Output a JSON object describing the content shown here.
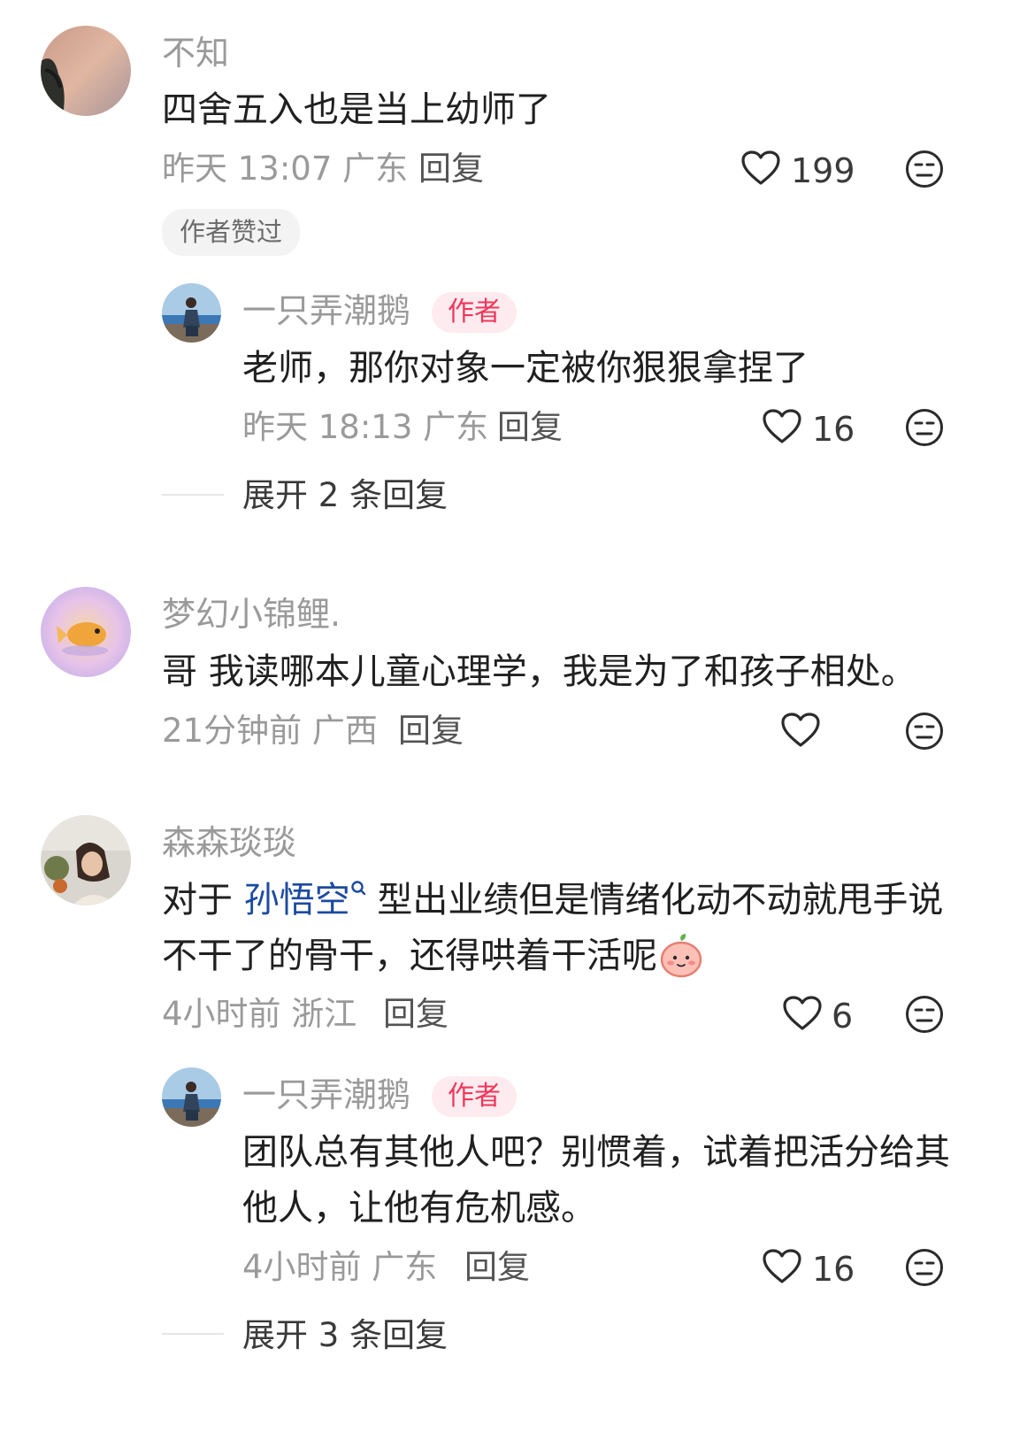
{
  "comments": [
    {
      "user": "不知",
      "text": "四舍五入也是当上幼师了",
      "time": "昨天 13:07 广东",
      "reply_label": "回复",
      "likes": "199",
      "badge": "作者赞过",
      "replies": [
        {
          "user": "一只弄潮鹅",
          "tag": "作者",
          "text": "老师，那你对象一定被你狠狠拿捏了",
          "time": "昨天 18:13 广东",
          "reply_label": "回复",
          "likes": "16"
        }
      ],
      "expand": "展开 2 条回复"
    },
    {
      "user": "梦幻小锦鲤.",
      "text": "哥 我读哪本儿童心理学，我是为了和孩子相处。",
      "time": "21分钟前 广西",
      "reply_label": "回复",
      "likes": ""
    },
    {
      "user": "森森琰琰",
      "text_prefix": "对于 ",
      "text_link": "孙悟空",
      "text_suffix_line1": " 型出业绩但是情绪化动不动就甩手说",
      "text_line2": "不干了的骨干，还得哄着干活呢",
      "time": "4小时前 浙江",
      "reply_label": "回复",
      "likes": "6",
      "replies": [
        {
          "user": "一只弄潮鹅",
          "tag": "作者",
          "text_line1": "团队总有其他人吧？别惯着，试着把活分给其",
          "text_line2": "他人，让他有危机感。",
          "time": "4小时前 广东",
          "reply_label": "回复",
          "likes": "16"
        }
      ],
      "expand": "展开 3 条回复"
    }
  ],
  "colors": {
    "meta_gray": "#9a9a9a",
    "author_tag_red": "#f1365a",
    "author_tag_bg": "#fdebef",
    "link_blue": "#1d4aa0"
  },
  "icons": [
    "heart-outline-icon",
    "expressionless-face-icon",
    "search-icon",
    "peach-emoji-icon"
  ]
}
